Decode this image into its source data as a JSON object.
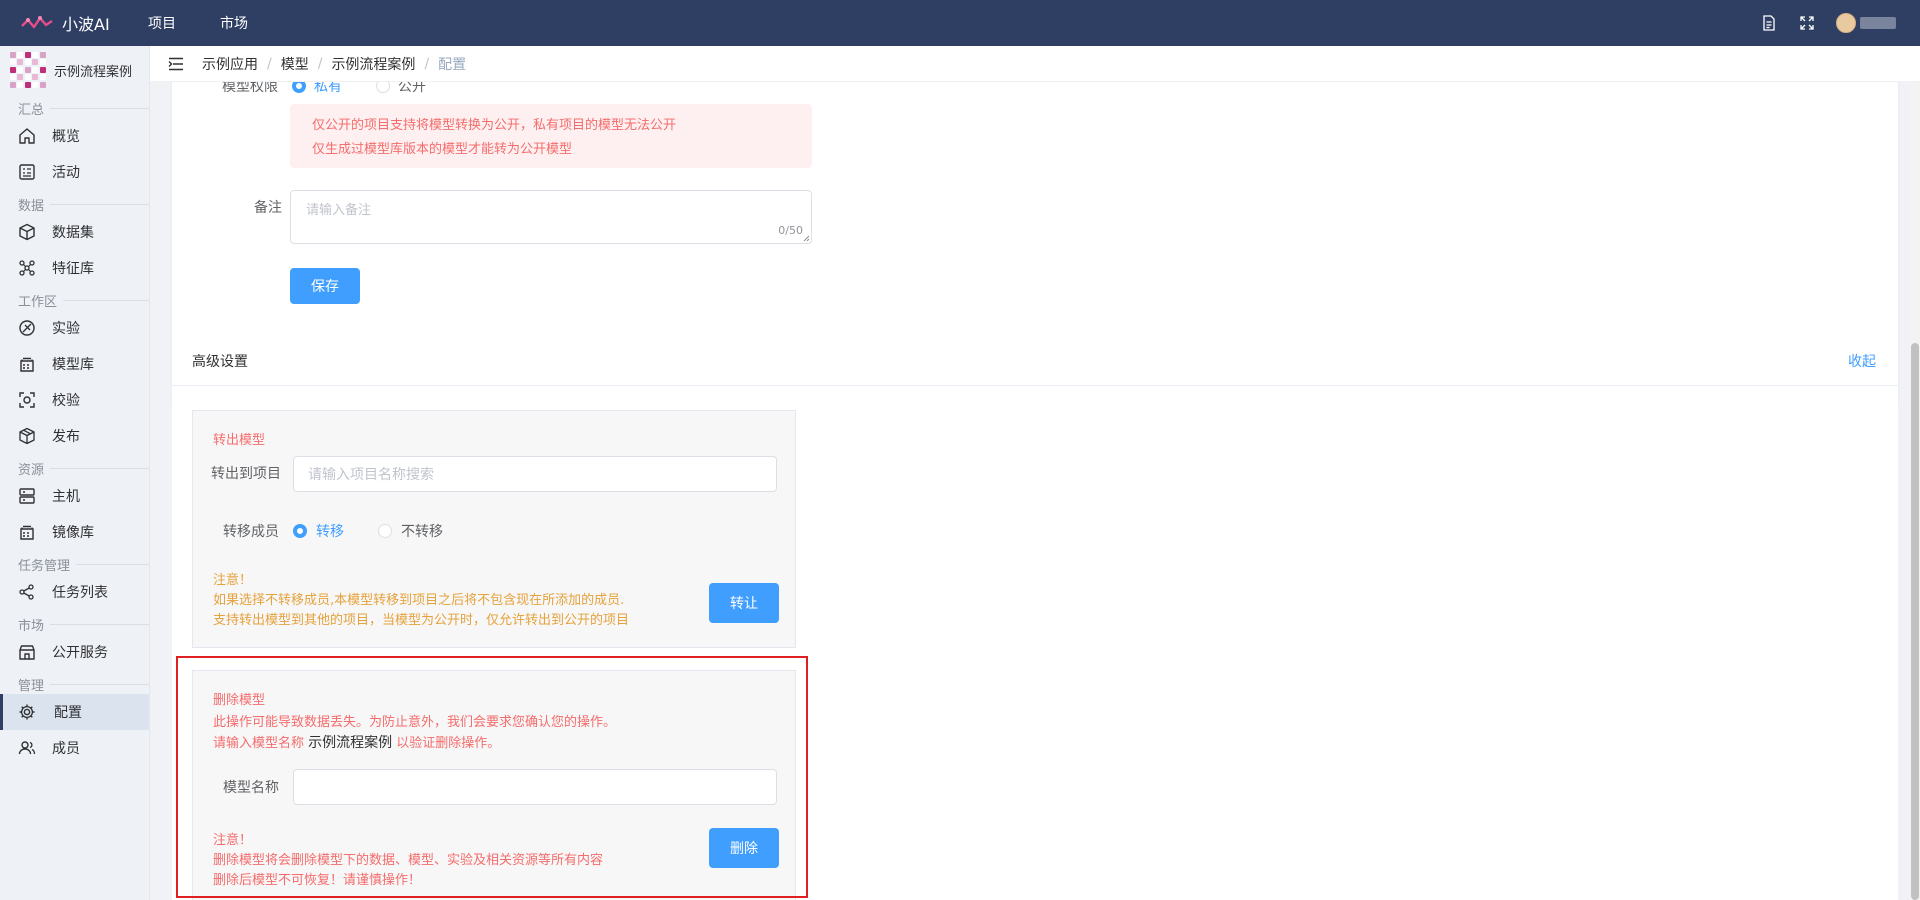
{
  "app": {
    "brand": "小波AI"
  },
  "topnav": [
    {
      "label": "项目"
    },
    {
      "label": "市场"
    }
  ],
  "topbar_icons": [
    "document-icon",
    "fullscreen-icon"
  ],
  "project": {
    "name": "示例流程案例"
  },
  "sidebar": {
    "sections": [
      {
        "title": "汇总",
        "items": [
          {
            "label": "概览",
            "icon": "home-icon"
          },
          {
            "label": "活动",
            "icon": "activity-icon"
          }
        ]
      },
      {
        "title": "数据",
        "items": [
          {
            "label": "数据集",
            "icon": "cube-icon"
          },
          {
            "label": "特征库",
            "icon": "nodes-icon"
          }
        ]
      },
      {
        "title": "工作区",
        "items": [
          {
            "label": "实验",
            "icon": "flask-icon"
          },
          {
            "label": "模型库",
            "icon": "stack-icon"
          },
          {
            "label": "校验",
            "icon": "scan-icon"
          },
          {
            "label": "发布",
            "icon": "box-icon"
          }
        ]
      },
      {
        "title": "资源",
        "items": [
          {
            "label": "主机",
            "icon": "server-icon"
          },
          {
            "label": "镜像库",
            "icon": "stack-icon"
          }
        ]
      },
      {
        "title": "任务管理",
        "items": [
          {
            "label": "任务列表",
            "icon": "share-icon"
          }
        ]
      },
      {
        "title": "市场",
        "items": [
          {
            "label": "公开服务",
            "icon": "store-icon"
          }
        ]
      },
      {
        "title": "管理",
        "items": [
          {
            "label": "配置",
            "icon": "gear-icon",
            "active": true
          },
          {
            "label": "成员",
            "icon": "users-icon"
          }
        ]
      }
    ]
  },
  "breadcrumb": [
    "示例应用",
    "模型",
    "示例流程案例",
    "配置"
  ],
  "settings": {
    "visibility_label": "模型权限",
    "visibility_options": [
      "私有",
      "公开"
    ],
    "notice_lines": [
      "仅公开的项目支持将模型转换为公开，私有项目的模型无法公开",
      "仅生成过模型库版本的模型才能转为公开模型"
    ],
    "remark_label": "备注",
    "remark_placeholder": "请输入备注",
    "remark_count": "0/50",
    "save_label": "保存"
  },
  "advanced": {
    "title": "高级设置",
    "collapse_label": "收起",
    "transfer": {
      "title": "转出模型",
      "project_label": "转出到项目",
      "project_placeholder": "请输入项目名称搜索",
      "members_label": "转移成员",
      "option_transfer": "转移",
      "option_no_transfer": "不转移",
      "warn_title": "注意！",
      "warn_line1": "如果选择不转移成员,本模型转移到项目之后将不包含现在所添加的成员.",
      "warn_line2": "支持转出模型到其他的项目，当模型为公开时，仅允许转出到公开的项目",
      "button": "转让"
    },
    "delete": {
      "title": "删除模型",
      "desc_line1": "此操作可能导致数据丢失。为防止意外，我们会要求您确认您的操作。",
      "desc_prefix": "请输入模型名称",
      "model_name": "示例流程案例",
      "desc_suffix": "以验证删除操作。",
      "name_label": "模型名称",
      "name_value": "",
      "warn_title": "注意！",
      "warn_line1": "删除模型将会删除模型下的数据、模型、实验及相关资源等所有内容",
      "warn_line2": "删除后模型不可恢复！请谨慎操作！",
      "button": "删除"
    }
  },
  "colors": {
    "topbar": "#2f3f64",
    "primary": "#409eff",
    "danger": "#f56c6c",
    "warning": "#e6a23c",
    "highlight": "#e02020"
  }
}
